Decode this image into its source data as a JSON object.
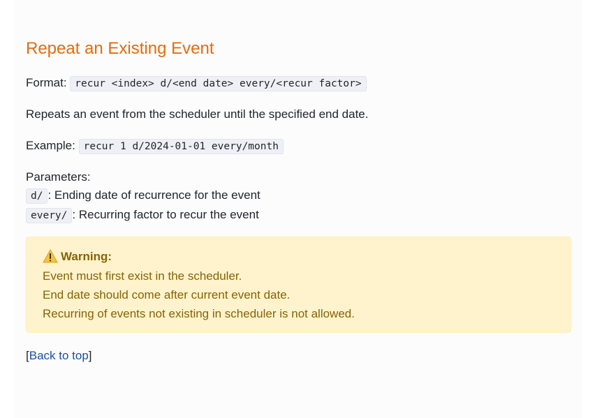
{
  "section": {
    "title": "Repeat an Existing Event",
    "format_label": "Format:",
    "format_code": "recur <index> d/<end date> every/<recur factor>",
    "description": "Repeats an event from the scheduler until the specified end date.",
    "example_label": "Example:",
    "example_code": "recur 1 d/2024-01-01 every/month",
    "parameters_label": "Parameters:",
    "parameters": [
      {
        "code": "d/",
        "desc": ": Ending date of recurrence for the event"
      },
      {
        "code": "every/",
        "desc": ": Recurring factor to recur the event"
      }
    ]
  },
  "warning": {
    "icon": "warning-icon",
    "title": "Warning:",
    "lines": [
      "Event must first exist in the scheduler.",
      "End date should come after current event date.",
      "Recurring of events not existing in scheduler is not allowed."
    ]
  },
  "back_link": {
    "open_bracket": "[",
    "label": "Back to top",
    "close_bracket": "]"
  },
  "colors": {
    "heading": "#e46c0a",
    "warning_bg": "#fff3cd",
    "warning_text": "#856404",
    "link": "#1a4fa0"
  }
}
